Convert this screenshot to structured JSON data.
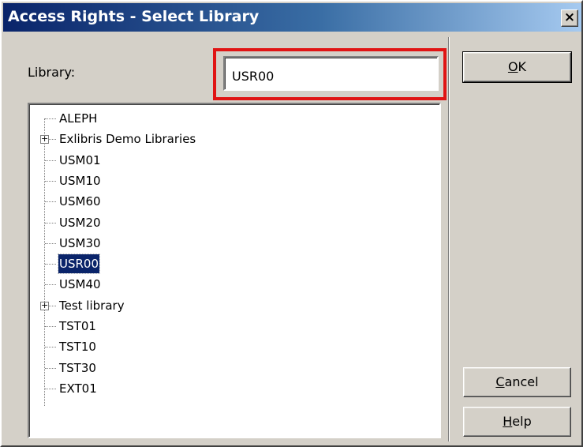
{
  "window": {
    "title": "Access Rights - Select Library",
    "close_glyph": "×"
  },
  "form": {
    "library_label": "Library:",
    "library_value": "USR00"
  },
  "tree": {
    "items": [
      {
        "label": "ALEPH",
        "expandable": false
      },
      {
        "label": "Exlibris Demo Libraries",
        "expandable": true
      },
      {
        "label": "USM01",
        "expandable": false
      },
      {
        "label": "USM10",
        "expandable": false
      },
      {
        "label": "USM60",
        "expandable": false
      },
      {
        "label": "USM20",
        "expandable": false
      },
      {
        "label": "USM30",
        "expandable": false
      },
      {
        "label": "USR00",
        "expandable": false,
        "selected": true
      },
      {
        "label": "USM40",
        "expandable": false
      },
      {
        "label": "Test library",
        "expandable": true
      },
      {
        "label": "TST01",
        "expandable": false
      },
      {
        "label": "TST10",
        "expandable": false
      },
      {
        "label": "TST30",
        "expandable": false
      },
      {
        "label": "EXT01",
        "expandable": false
      }
    ],
    "expander_glyph": "+"
  },
  "buttons": {
    "ok": {
      "mnemonic": "O",
      "rest": "K"
    },
    "cancel": {
      "mnemonic": "C",
      "rest": "ancel"
    },
    "help": {
      "mnemonic": "H",
      "rest": "elp"
    }
  },
  "colors": {
    "highlight": "#e01414",
    "selection": "#0a246a",
    "titlebar": "#0a246a"
  }
}
